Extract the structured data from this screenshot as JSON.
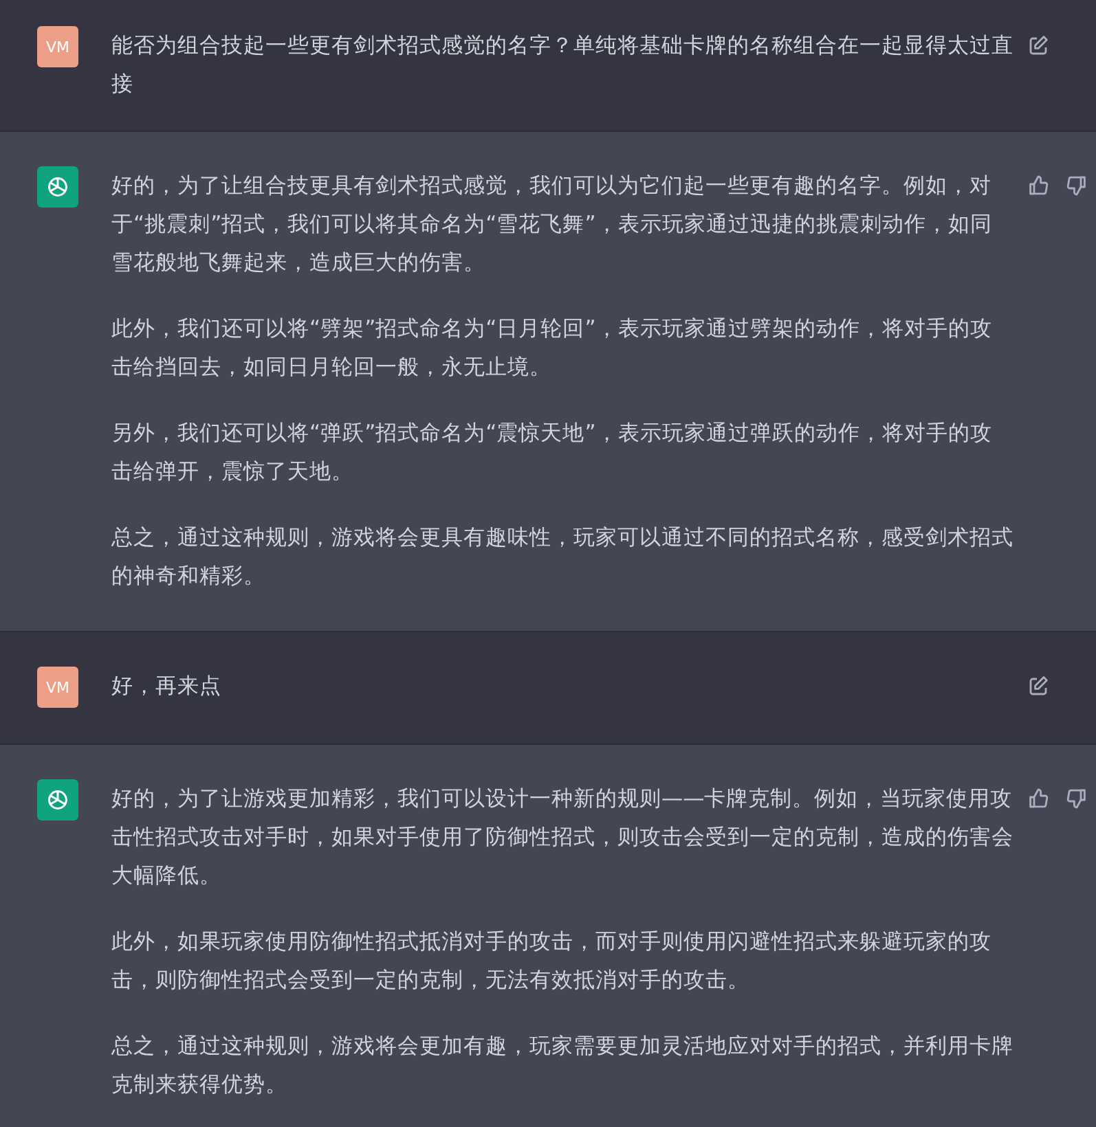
{
  "messages": [
    {
      "kind": "user",
      "avatar": "VM",
      "paragraphs": [
        "能否为组合技起一些更有剑术招式感觉的名字？单纯将基础卡牌的名称组合在一起显得太过直接"
      ]
    },
    {
      "kind": "assistant",
      "paragraphs": [
        "好的，为了让组合技更具有剑术招式感觉，我们可以为它们起一些更有趣的名字。例如，对于“挑震刺”招式，我们可以将其命名为“雪花飞舞”，表示玩家通过迅捷的挑震刺动作，如同雪花般地飞舞起来，造成巨大的伤害。",
        "此外，我们还可以将“劈架”招式命名为“日月轮回”，表示玩家通过劈架的动作，将对手的攻击给挡回去，如同日月轮回一般，永无止境。",
        "另外，我们还可以将“弹跃”招式命名为“震惊天地”，表示玩家通过弹跃的动作，将对手的攻击给弹开，震惊了天地。",
        "总之，通过这种规则，游戏将会更具有趣味性，玩家可以通过不同的招式名称，感受剑术招式的神奇和精彩。"
      ]
    },
    {
      "kind": "user",
      "avatar": "VM",
      "paragraphs": [
        "好，再来点"
      ]
    },
    {
      "kind": "assistant",
      "paragraphs": [
        "好的，为了让游戏更加精彩，我们可以设计一种新的规则——卡牌克制。例如，当玩家使用攻击性招式攻击对手时，如果对手使用了防御性招式，则攻击会受到一定的克制，造成的伤害会大幅降低。",
        "此外，如果玩家使用防御性招式抵消对手的攻击，而对手则使用闪避性招式来躲避玩家的攻击，则防御性招式会受到一定的克制，无法有效抵消对手的攻击。",
        "总之，通过这种规则，游戏将会更加有趣，玩家需要更加灵活地应对对手的招式，并利用卡牌克制来获得优势。"
      ]
    }
  ]
}
